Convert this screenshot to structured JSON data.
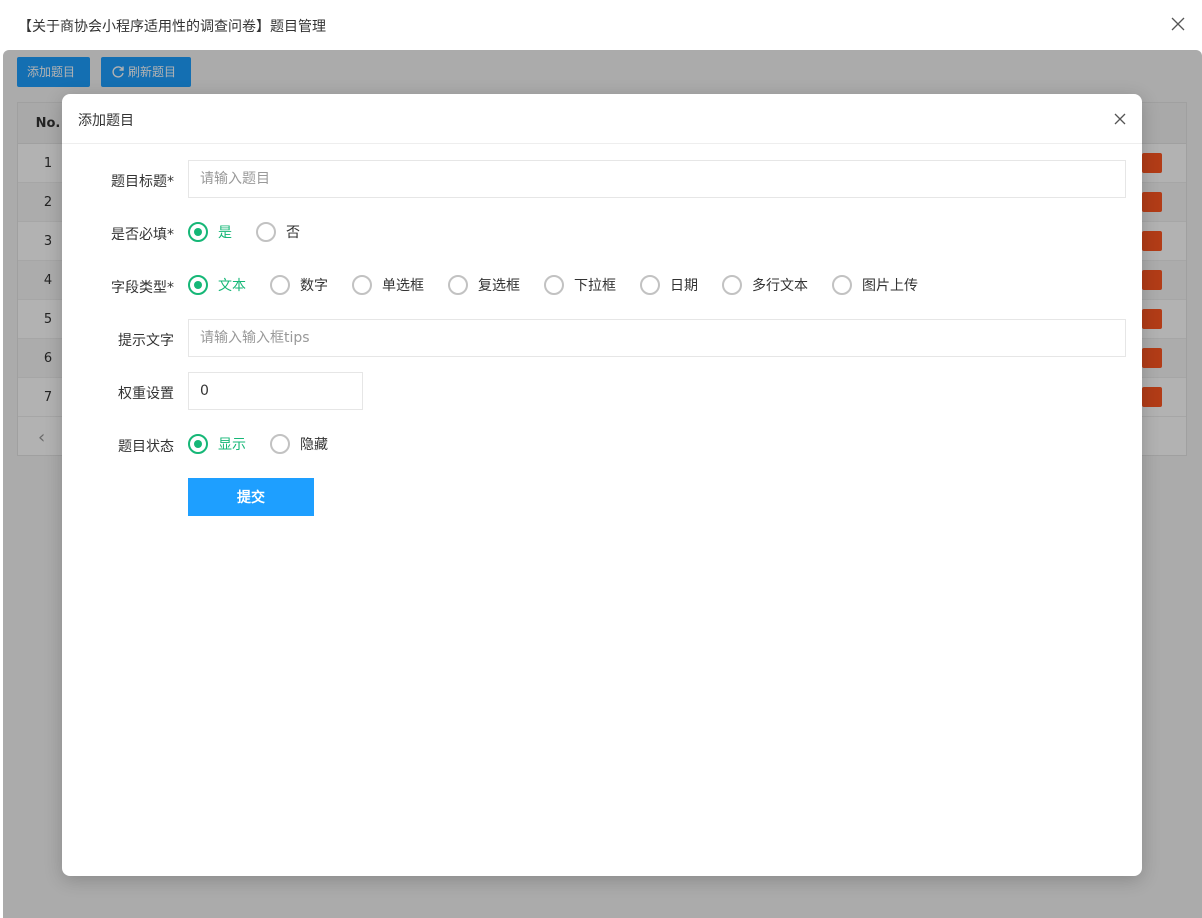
{
  "window": {
    "title": "【关于商协会小程序适用性的调查问卷】题目管理"
  },
  "toolbar": {
    "add_label": "添加题目",
    "refresh_label": "刷新题目"
  },
  "table": {
    "no_header": "No.",
    "rows": [
      "1",
      "2",
      "3",
      "4",
      "5",
      "6",
      "7"
    ]
  },
  "modal": {
    "title": "添加题目",
    "title_field": {
      "label": "题目标题*",
      "placeholder": "请输入题目",
      "value": ""
    },
    "required_field": {
      "label": "是否必填*",
      "options": [
        "是",
        "否"
      ],
      "selected": "是"
    },
    "type_field": {
      "label": "字段类型*",
      "options": [
        "文本",
        "数字",
        "单选框",
        "复选框",
        "下拉框",
        "日期",
        "多行文本",
        "图片上传"
      ],
      "selected": "文本"
    },
    "tips_field": {
      "label": "提示文字",
      "placeholder": "请输入输入框tips",
      "value": ""
    },
    "weight_field": {
      "label": "权重设置",
      "value": "0"
    },
    "status_field": {
      "label": "题目状态",
      "options": [
        "显示",
        "隐藏"
      ],
      "selected": "显示"
    },
    "submit_label": "提交"
  },
  "colors": {
    "primary": "#1e9fff",
    "checked": "#16b777",
    "danger": "#ff5722"
  }
}
